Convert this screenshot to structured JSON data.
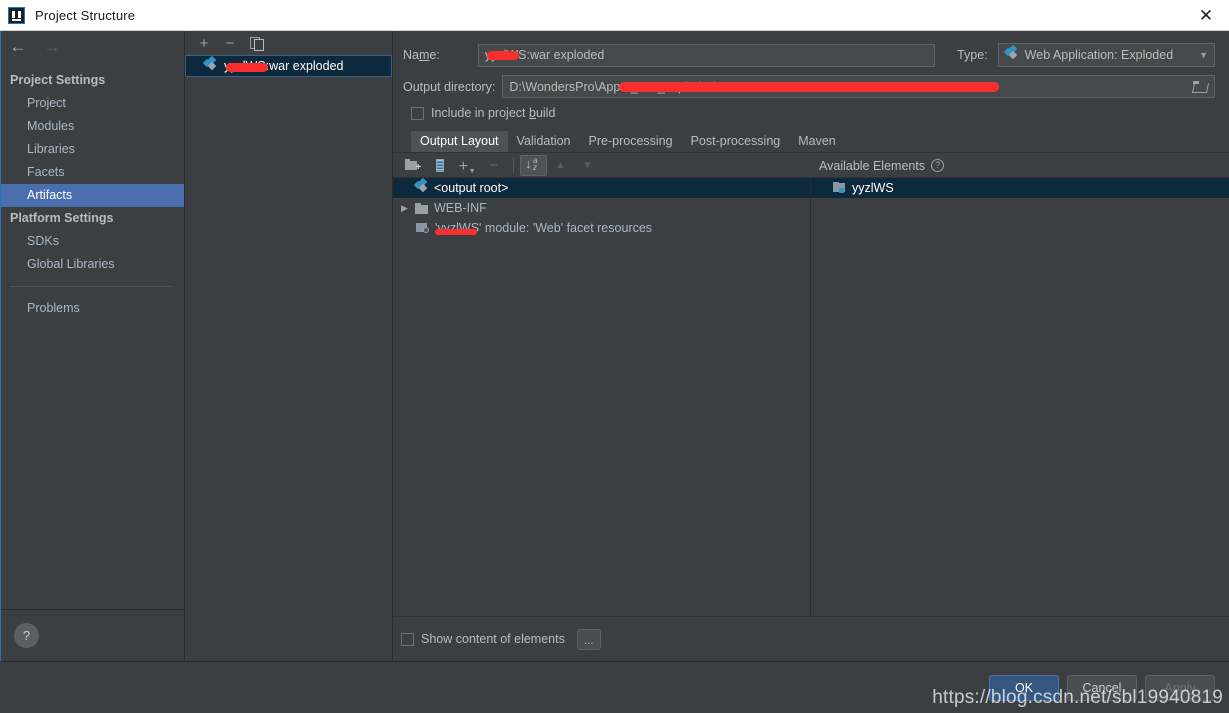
{
  "window": {
    "title": "Project Structure",
    "close_label": "✕",
    "app_icon": "intellij-idea-icon"
  },
  "sidebar": {
    "back_arrow": "←",
    "forward_arrow": "→",
    "groups": [
      {
        "label": "Project Settings",
        "items": [
          {
            "label": "Project",
            "selected": false
          },
          {
            "label": "Modules",
            "selected": false
          },
          {
            "label": "Libraries",
            "selected": false
          },
          {
            "label": "Facets",
            "selected": false
          },
          {
            "label": "Artifacts",
            "selected": true
          }
        ]
      },
      {
        "label": "Platform Settings",
        "items": [
          {
            "label": "SDKs",
            "selected": false
          },
          {
            "label": "Global Libraries",
            "selected": false
          }
        ]
      }
    ],
    "extra_items": [
      {
        "label": "Problems",
        "selected": false
      }
    ],
    "help_button": "?"
  },
  "artifacts_panel": {
    "toolbar": {
      "add": "+",
      "remove": "−",
      "copy": "copy-icon"
    },
    "items": [
      {
        "label": "yyzlWS:war exploded",
        "selected": true,
        "redacted": true
      }
    ]
  },
  "detail": {
    "name_label": "Name:",
    "name_label_mnemonic": "m",
    "name_value": "yyzlWS:war exploded",
    "type_label": "Type:",
    "type_value": "Web Application: Exploded",
    "type_caret": "▼",
    "output_dir_label": "Output directory:",
    "output_dir_value": "D:\\WondersPro\\Appo                                             _war_exploded",
    "output_dir_prefix": "D:\\WondersPro\\Appo",
    "output_dir_suffix": "_war_exploded",
    "include_in_build_label": "Include in project build",
    "include_in_build_mnemonic": "b",
    "include_in_build_checked": false,
    "tabs": [
      {
        "label": "Output Layout",
        "active": true
      },
      {
        "label": "Validation",
        "active": false
      },
      {
        "label": "Pre-processing",
        "active": false
      },
      {
        "label": "Post-processing",
        "active": false
      },
      {
        "label": "Maven",
        "active": false
      }
    ],
    "layout_toolbar": [
      {
        "name": "create-directory",
        "icon": "new-folder-icon",
        "enabled": true,
        "toggled": false
      },
      {
        "name": "create-archive",
        "icon": "archive-icon",
        "enabled": true,
        "toggled": false
      },
      {
        "name": "add-element",
        "icon": "plus-dropdown-icon",
        "enabled": true,
        "toggled": false
      },
      {
        "name": "remove-element",
        "icon": "minus-icon",
        "enabled": false,
        "toggled": false
      },
      {
        "name": "sort-elements",
        "icon": "sort-az-icon",
        "enabled": true,
        "toggled": true
      },
      {
        "name": "move-up",
        "icon": "arrow-up-icon",
        "enabled": false,
        "toggled": false
      },
      {
        "name": "move-down",
        "icon": "arrow-down-icon",
        "enabled": false,
        "toggled": false
      }
    ],
    "tree": [
      {
        "label": "<output root>",
        "icon": "artifact-icon",
        "indent": 0,
        "selected": true,
        "twisty": "",
        "redacted": false
      },
      {
        "label": "WEB-INF",
        "icon": "folder-icon",
        "indent": 0,
        "selected": false,
        "twisty": "▶",
        "redacted": false
      },
      {
        "label": "'yyzlWS' module: 'Web' facet resources",
        "icon": "module-facet-icon",
        "indent": 1,
        "selected": false,
        "twisty": "",
        "redacted": true
      }
    ],
    "available_elements": {
      "title": "Available Elements",
      "help": "?",
      "items": [
        {
          "label": "yyzlWS",
          "icon": "module-icon",
          "selected": true
        }
      ]
    },
    "show_content_label": "Show content of elements",
    "show_content_checked": false,
    "ellipsis_button": "..."
  },
  "footer": {
    "buttons": [
      {
        "label": "OK",
        "style": "primary",
        "enabled": true
      },
      {
        "label": "Cancel",
        "style": "default",
        "enabled": true
      },
      {
        "label": "Apply",
        "style": "default",
        "enabled": false
      }
    ],
    "watermark": "https://blog.csdn.net/sbl19940819"
  }
}
